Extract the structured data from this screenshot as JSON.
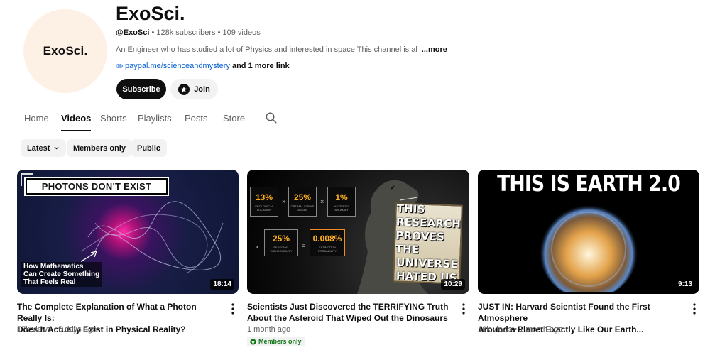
{
  "channel": {
    "avatar_text": "ExoSci.",
    "name": "ExoSci.",
    "handle": "@ExoSci",
    "stats": " • 128k subscribers • 109 videos",
    "description": "An Engineer who has studied a lot of Physics and  interested in space This channel is al",
    "description_fade": "l ...",
    "more": "...more",
    "link_url": "paypal.me/scienceandmystery",
    "link_extra": "and 1 more link",
    "subscribe_label": "Subscribe",
    "join_label": "Join"
  },
  "tabs": [
    {
      "label": "Home",
      "active": false
    },
    {
      "label": "Videos",
      "active": true
    },
    {
      "label": "Shorts",
      "active": false
    },
    {
      "label": "Playlists",
      "active": false
    },
    {
      "label": "Posts",
      "active": false
    },
    {
      "label": "Store",
      "active": false
    }
  ],
  "filters": {
    "sort_label": "Latest",
    "members_only": "Members only",
    "public": "Public"
  },
  "videos": [
    {
      "title_line1": "The Complete Explanation of What a Photon Really Is:",
      "title_line2": "Does It Actually Exist in Physical Reality?",
      "meta": "17k views • 5 days ago",
      "duration": "18:14",
      "thumb_banner": "PHOTONS DON'T EXIST",
      "thumb_sub1": "How Mathematics",
      "thumb_sub2": "Can Create Something",
      "thumb_sub3": "That Feels Real"
    },
    {
      "title_line1": "Scientists Just Discovered the TERRIFYING Truth",
      "title_line2": "About the Asteroid That Wiped Out the Dinosaurs",
      "meta": "1 month ago",
      "badge": "Members only",
      "duration": "10:29",
      "stats": [
        {
          "value": "13%",
          "label": "GEOLOGICAL LOCATION"
        },
        {
          "value": "25%",
          "label": "OPTIMAL STRIKE ANGLE"
        },
        {
          "value": "1%",
          "label": "ASTEROID ANOMALY"
        },
        {
          "value": "25%",
          "label": "SEASONAL VULNERABILITY"
        },
        {
          "value": "0.008%",
          "label": "EXTINCTION PROBABILITY"
        }
      ],
      "banner_lines": [
        "THIS RESEARCH",
        "PROVES THE",
        "UNIVERSE",
        "HATED US"
      ]
    },
    {
      "title_line1": "JUST IN: Harvard Scientist Found the First Atmosphere",
      "title_line2": "Around a Planet Exactly Like Our Earth...",
      "meta": "16k views • 1 month ago",
      "duration": "9:13",
      "thumb_title": "THIS IS EARTH 2.0"
    }
  ],
  "colors": {
    "link": "#065fd4",
    "members_badge": "#107516",
    "avatar_bg": "#fdf1e6"
  }
}
